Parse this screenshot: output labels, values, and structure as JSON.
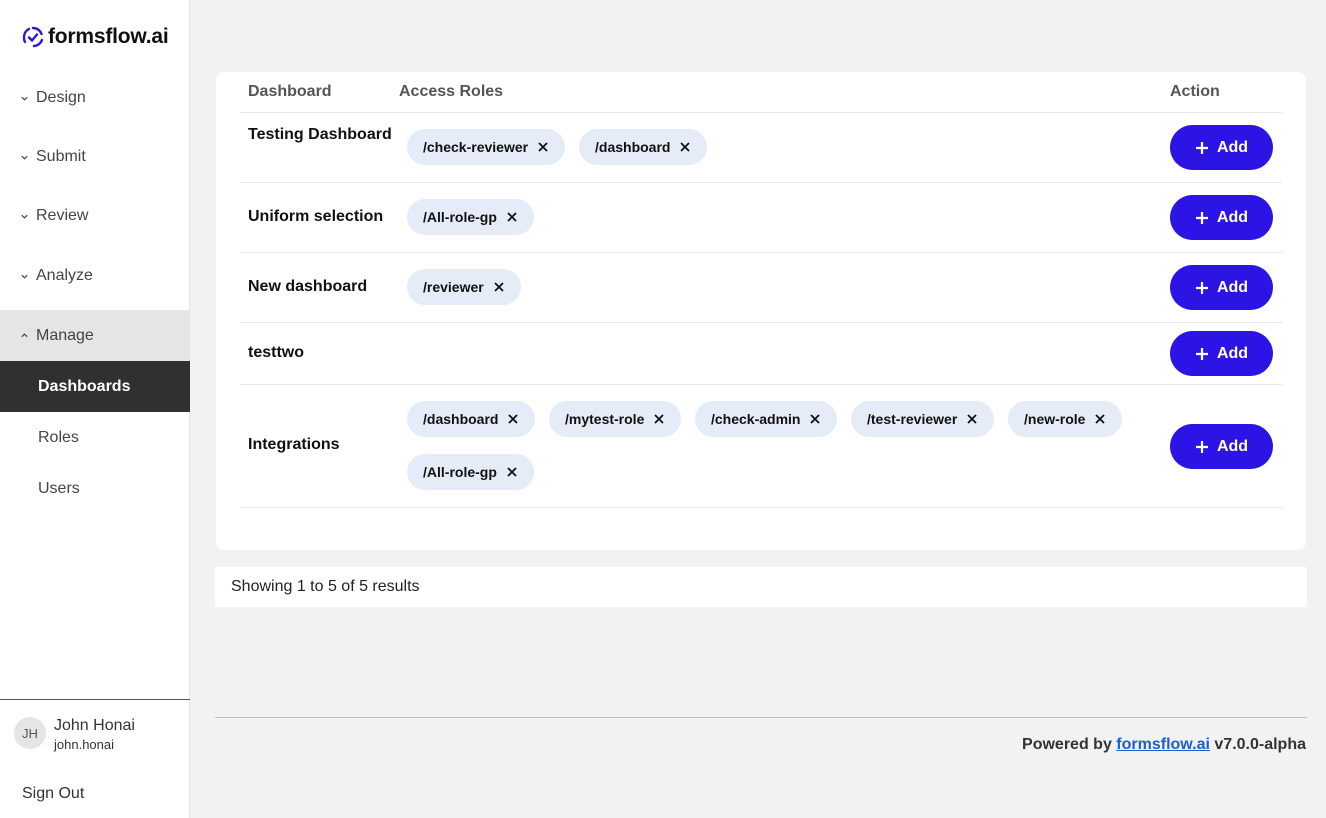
{
  "brand": {
    "name": "formsflow.ai"
  },
  "nav": {
    "design": "Design",
    "submit": "Submit",
    "review": "Review",
    "analyze": "Analyze",
    "manage": "Manage",
    "sub": {
      "dashboards": "Dashboards",
      "roles": "Roles",
      "users": "Users"
    }
  },
  "user": {
    "initials": "JH",
    "name": "John Honai",
    "login": "john.honai",
    "sign_out": "Sign Out"
  },
  "table": {
    "headers": {
      "dashboard": "Dashboard",
      "roles": "Access Roles",
      "action": "Action"
    },
    "add_label": "Add",
    "rows": [
      {
        "name": "Testing Dashboard",
        "roles": [
          "/check-reviewer",
          "/dashboard"
        ]
      },
      {
        "name": "Uniform selection",
        "roles": [
          "/All-role-gp"
        ]
      },
      {
        "name": "New dashboard",
        "roles": [
          "/reviewer"
        ]
      },
      {
        "name": "testtwo",
        "roles": []
      },
      {
        "name": "Integrations",
        "roles": [
          "/dashboard",
          "/mytest-role",
          "/check-admin",
          "/test-reviewer",
          "/new-role",
          "/All-role-gp"
        ]
      }
    ]
  },
  "pagination": {
    "summary": "Showing 1 to 5 of 5 results"
  },
  "footer": {
    "powered_by": "Powered by",
    "link": "formsflow.ai",
    "version": "v7.0.0-alpha"
  },
  "colors": {
    "primary": "#2c14e4",
    "chip_bg": "#e6ebf8",
    "active_nav": "#2f3131"
  }
}
